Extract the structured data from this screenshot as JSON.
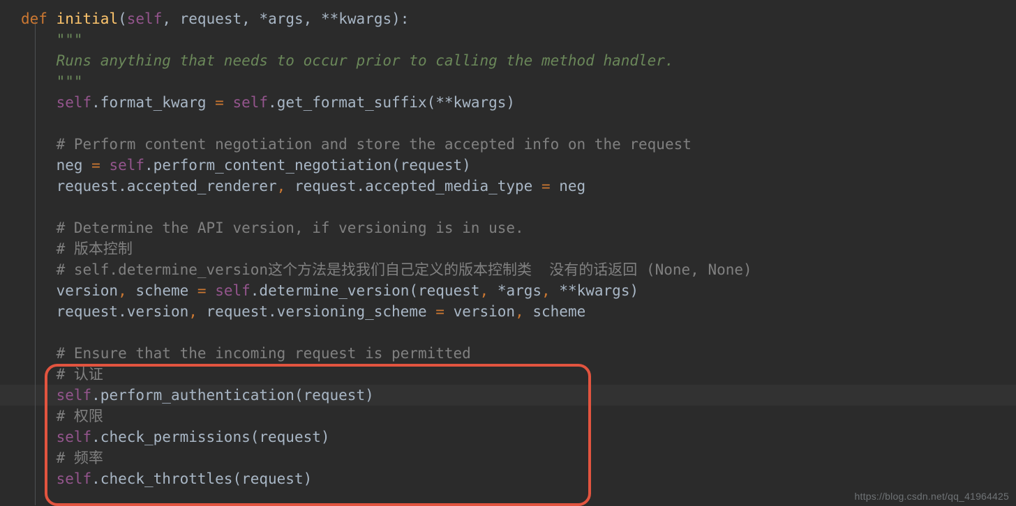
{
  "colors": {
    "bg": "#2b2b2b",
    "keyword": "#cc7832",
    "function": "#ffc66d",
    "self": "#94558d",
    "comment": "#808080",
    "doc": "#6a8759",
    "text": "#a9b7c6",
    "highlight_box": "#e2543f"
  },
  "watermark": "https://blog.csdn.net/qq_41964425",
  "code": {
    "def_kw": "def",
    "func_name": "initial",
    "params_open": "(",
    "params_self": "self",
    "sep": ", ",
    "p_request": "request",
    "p_args": "*args",
    "p_kwargs": "**kwargs",
    "params_close": "):",
    "tq1": "\"\"\"",
    "doc_line": "Runs anything that needs to occur prior to calling the method handler.",
    "tq2": "\"\"\"",
    "l5_self1": "self",
    "l5_dot_fk": ".format_kwarg ",
    "l5_eq": "= ",
    "l5_self2": "self",
    "l5_call": ".get_format_suffix(**kwargs)",
    "c1": "# Perform content negotiation and store the accepted info on the request",
    "l8_lhs": "neg ",
    "l8_eq": "= ",
    "l8_self": "self",
    "l8_call": ".perform_content_negotiation(request)",
    "l9_lhs": "request.accepted_renderer",
    "l9_sep": ", ",
    "l9_lhs2": "request.accepted_media_type ",
    "l9_eq": "= ",
    "l9_rhs": "neg",
    "c2": "# Determine the API version, if versioning is in use.",
    "c3": "# 版本控制",
    "c4": "# self.determine_version这个方法是找我们自己定义的版本控制类  没有的话返回 (None, None)",
    "l14_lhs": "version",
    "l14_sep": ", ",
    "l14_lhs2": "scheme ",
    "l14_eq": "= ",
    "l14_self": "self",
    "l14_call": ".determine_version(request",
    "l14_sep2": ", ",
    "l14_args": "*args",
    "l14_sep3": ", ",
    "l14_kwargs": "**kwargs)",
    "l15_a": "request.version",
    "l15_sep": ", ",
    "l15_b": "request.versioning_scheme ",
    "l15_eq": "= ",
    "l15_c": "version",
    "l15_sep2": ", ",
    "l15_d": "scheme",
    "c5": "# Ensure that the incoming request is permitted",
    "c6": "# 认证",
    "l19_self": "self",
    "l19_call": ".perform_authentication(request)",
    "c7": "# 权限",
    "l21_self": "self",
    "l21_call": ".check_permissions(request)",
    "c8": "# 频率",
    "l23_self": "self",
    "l23_call": ".check_throttles(request)"
  }
}
